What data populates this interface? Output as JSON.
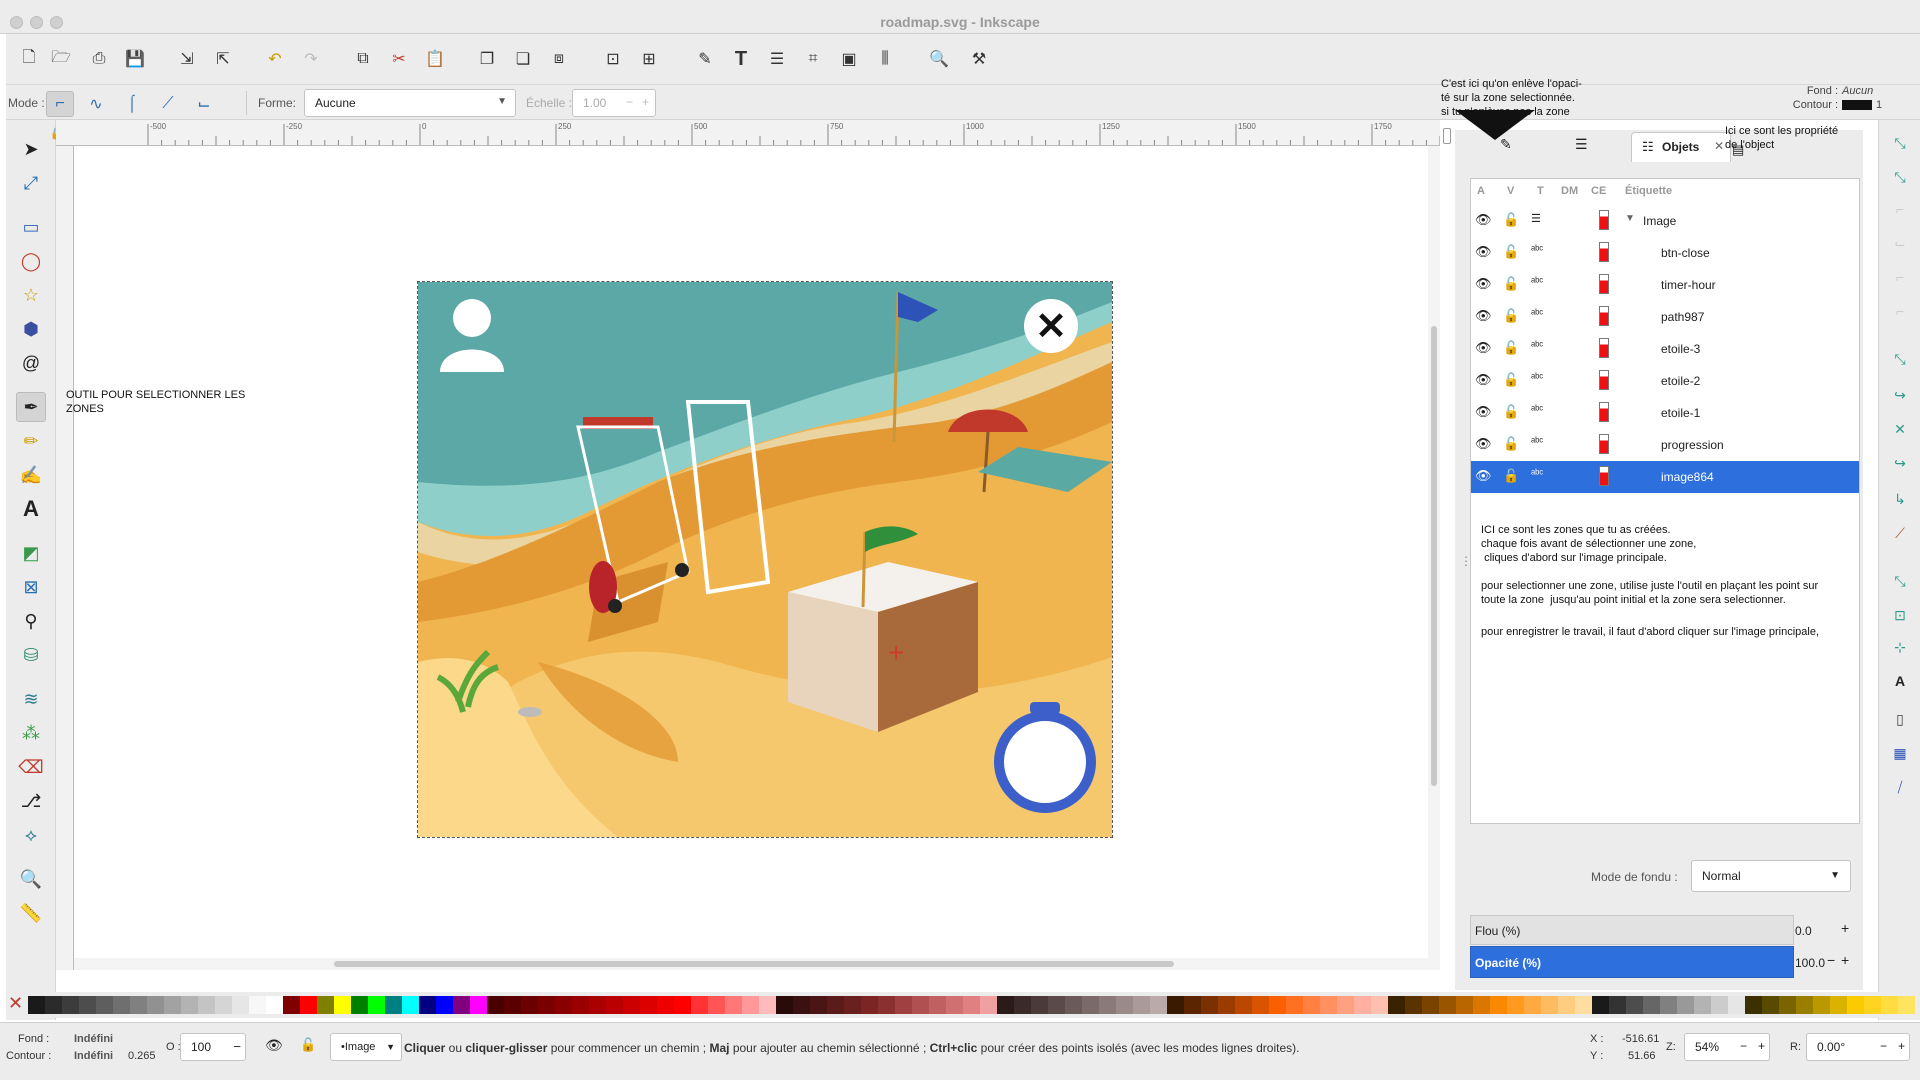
{
  "window": {
    "title": "roadmap.svg - Inkscape"
  },
  "toolctl": {
    "mode_label": "Mode :",
    "forme_label": "Forme:",
    "forme_value": "Aucune",
    "echelle_label": "Échelle :",
    "echelle_value": "1.00"
  },
  "style_indicator": {
    "fond_label": "Fond :",
    "fond_value": "Aucun",
    "contour_label": "Contour :",
    "contour_value": "1"
  },
  "annotations": {
    "opacity_note": "C'est ici qu'on enlève l'opaci-\nté sur la zone selectionnée.\nsi tu n'enlèves pas la zone",
    "props_note": "Ici ce sont les propriété\nde l'object",
    "tool_note": "OUTIL POUR SELECTIONNER LES\nZONES",
    "panel_note_1": "ICI ce sont les zones que tu as créées.\nchaque fois avant de sélectionner une zone,\n cliques d'abord sur l'image principale.",
    "panel_note_2": "pour selectionner une zone, utilise juste l'outil en plaçant les point sur\ntoute la zone  jusqu'au point initial et la zone sera selectionner.",
    "panel_note_3": "pour enregistrer le travail, il faut d'abord cliquer sur l'image principale,"
  },
  "ruler": {
    "ticks": [
      "-500",
      "-250",
      "0",
      "250",
      "500",
      "750",
      "1000",
      "1250",
      "1500",
      "1750"
    ]
  },
  "objects_panel": {
    "tab_label": "Objets",
    "columns": [
      "A",
      "V",
      "T",
      "DM",
      "CE",
      "Étiquette"
    ],
    "rows": [
      {
        "label": "Image",
        "group": true,
        "selected": false
      },
      {
        "label": "btn-close",
        "group": false,
        "selected": false
      },
      {
        "label": "timer-hour",
        "group": false,
        "selected": false
      },
      {
        "label": "path987",
        "group": false,
        "selected": false
      },
      {
        "label": "etoile-3",
        "group": false,
        "selected": false
      },
      {
        "label": "etoile-2",
        "group": false,
        "selected": false
      },
      {
        "label": "etoile-1",
        "group": false,
        "selected": false
      },
      {
        "label": "progression",
        "group": false,
        "selected": false
      },
      {
        "label": "image864",
        "group": false,
        "selected": true
      }
    ],
    "blend_label": "Mode de fondu :",
    "blend_value": "Normal",
    "blur_label": "Flou (%)",
    "blur_value": "0.0",
    "opacity_label": "Opacité (%)",
    "opacity_value": "100.0"
  },
  "status": {
    "fond_label": "Fond :",
    "fond_value": "Indéfini",
    "contour_label": "Contour :",
    "contour_value": "Indéfini",
    "contour_width": "0.265",
    "o_label": "O :",
    "o_value": "100",
    "layer_value": "•Image",
    "message_b1": "Cliquer",
    "message_t1": " ou ",
    "message_b2": "cliquer-glisser",
    "message_t2": " pour commencer un chemin ; ",
    "message_b3": "Maj",
    "message_t3": " pour ajouter au chemin sélectionné ; ",
    "message_b4": "Ctrl+clic",
    "message_t4": " pour créer des points isolés (avec les modes lignes droites).",
    "x_label": "X :",
    "x_value": "-516.61",
    "y_label": "Y :",
    "y_value": "51.66",
    "z_label": "Z:",
    "zoom_value": "54%",
    "r_label": "R:",
    "rotation_value": "0.00°"
  },
  "colors": {
    "accent": "#2d6fdc"
  }
}
